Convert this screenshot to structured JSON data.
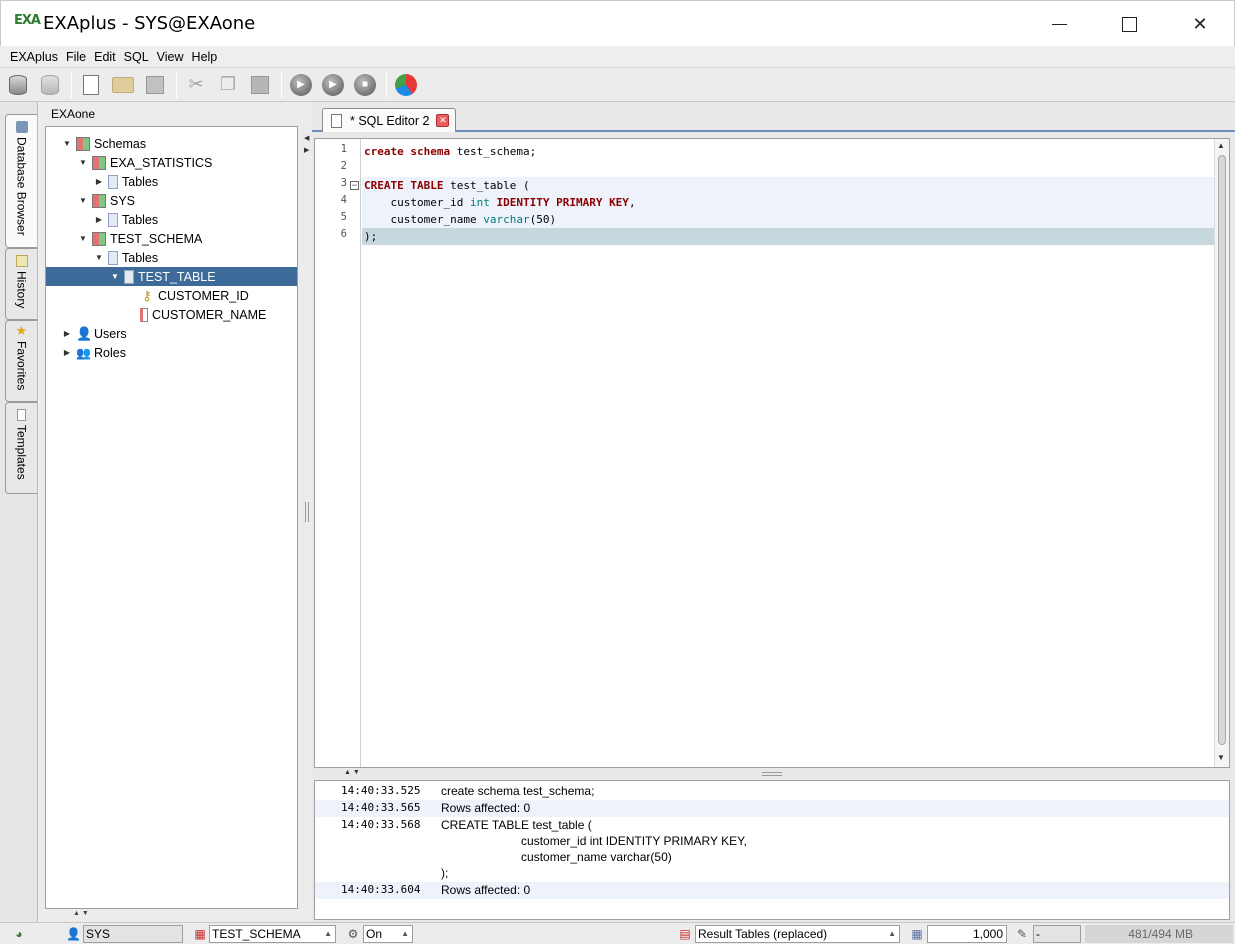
{
  "window": {
    "title": "EXAplus - SYS@EXAone",
    "logo_text": "EXA"
  },
  "menu": [
    "EXAplus",
    "File",
    "Edit",
    "SQL",
    "View",
    "Help"
  ],
  "toolbar": {
    "icons": [
      "connect-icon",
      "disconnect-icon",
      "new-editor-icon",
      "open-icon",
      "save-icon",
      "cut-icon",
      "copy-icon",
      "paste-icon",
      "execute-icon",
      "execute-current-icon",
      "stop-icon",
      "chart-icon"
    ]
  },
  "side_tabs": [
    "Database Browser",
    "History",
    "Favorites",
    "Templates"
  ],
  "browser": {
    "connection": "EXAone",
    "tree": [
      {
        "label": "Schemas",
        "level": 0,
        "expanded": true,
        "icon": "schema-icon"
      },
      {
        "label": "EXA_STATISTICS",
        "level": 1,
        "expanded": true,
        "icon": "schema-icon"
      },
      {
        "label": "Tables",
        "level": 2,
        "expanded": false,
        "icon": "tables-icon"
      },
      {
        "label": "SYS",
        "level": 1,
        "expanded": true,
        "icon": "schema-icon"
      },
      {
        "label": "Tables",
        "level": 2,
        "expanded": false,
        "icon": "tables-icon"
      },
      {
        "label": "TEST_SCHEMA",
        "level": 1,
        "expanded": true,
        "icon": "schema-icon"
      },
      {
        "label": "Tables",
        "level": 2,
        "expanded": true,
        "icon": "tables-icon"
      },
      {
        "label": "TEST_TABLE",
        "level": 3,
        "expanded": true,
        "icon": "table-icon",
        "selected": true
      },
      {
        "label": "CUSTOMER_ID",
        "level": 4,
        "icon": "key-icon"
      },
      {
        "label": "CUSTOMER_NAME",
        "level": 4,
        "icon": "column-icon"
      },
      {
        "label": "Users",
        "level": 0,
        "expanded": false,
        "icon": "user-icon"
      },
      {
        "label": "Roles",
        "level": 0,
        "expanded": false,
        "icon": "roles-icon"
      }
    ]
  },
  "editor": {
    "tab_label": "* SQL Editor 2",
    "line_numbers": [
      "1",
      "2",
      "3",
      "4",
      "5",
      "6"
    ],
    "lines": [
      [
        [
          "kw",
          "create"
        ],
        [
          "t",
          " "
        ],
        [
          "kw",
          "schema"
        ],
        [
          "t",
          " test_schema;"
        ]
      ],
      [],
      [
        [
          "kw",
          "CREATE"
        ],
        [
          "t",
          " "
        ],
        [
          "kw",
          "TABLE"
        ],
        [
          "t",
          " test_table ("
        ]
      ],
      [
        [
          "t",
          "    customer_id "
        ],
        [
          "ty",
          "int"
        ],
        [
          "t",
          " "
        ],
        [
          "kw",
          "IDENTITY"
        ],
        [
          "t",
          " "
        ],
        [
          "kw",
          "PRIMARY"
        ],
        [
          "t",
          " "
        ],
        [
          "kw",
          "KEY"
        ],
        [
          "t",
          ","
        ]
      ],
      [
        [
          "t",
          "    customer_name "
        ],
        [
          "ty",
          "varchar"
        ],
        [
          "t",
          "(50)"
        ]
      ],
      [
        [
          "t",
          ");"
        ]
      ]
    ]
  },
  "log": [
    {
      "time": "14:40:33.525",
      "message": "create schema test_schema;"
    },
    {
      "time": "14:40:33.565",
      "message": "Rows affected: 0"
    },
    {
      "time": "14:40:33.568",
      "message": "CREATE TABLE test_table (\n                        customer_id int IDENTITY PRIMARY KEY,\n                        customer_name varchar(50)\n);"
    },
    {
      "time": "14:40:33.604",
      "message": "Rows affected: 0"
    }
  ],
  "status": {
    "user": "SYS",
    "schema": "TEST_SCHEMA",
    "autocommit": "On",
    "result_mode": "Result Tables (replaced)",
    "row_limit": "1,000",
    "editor_field": "-",
    "memory": "481/494 MB"
  },
  "colors": {
    "selection": "#3d6a99",
    "keyword": "#8b0000",
    "type": "#007a7a",
    "tab_underline": "#6b8fbf"
  }
}
